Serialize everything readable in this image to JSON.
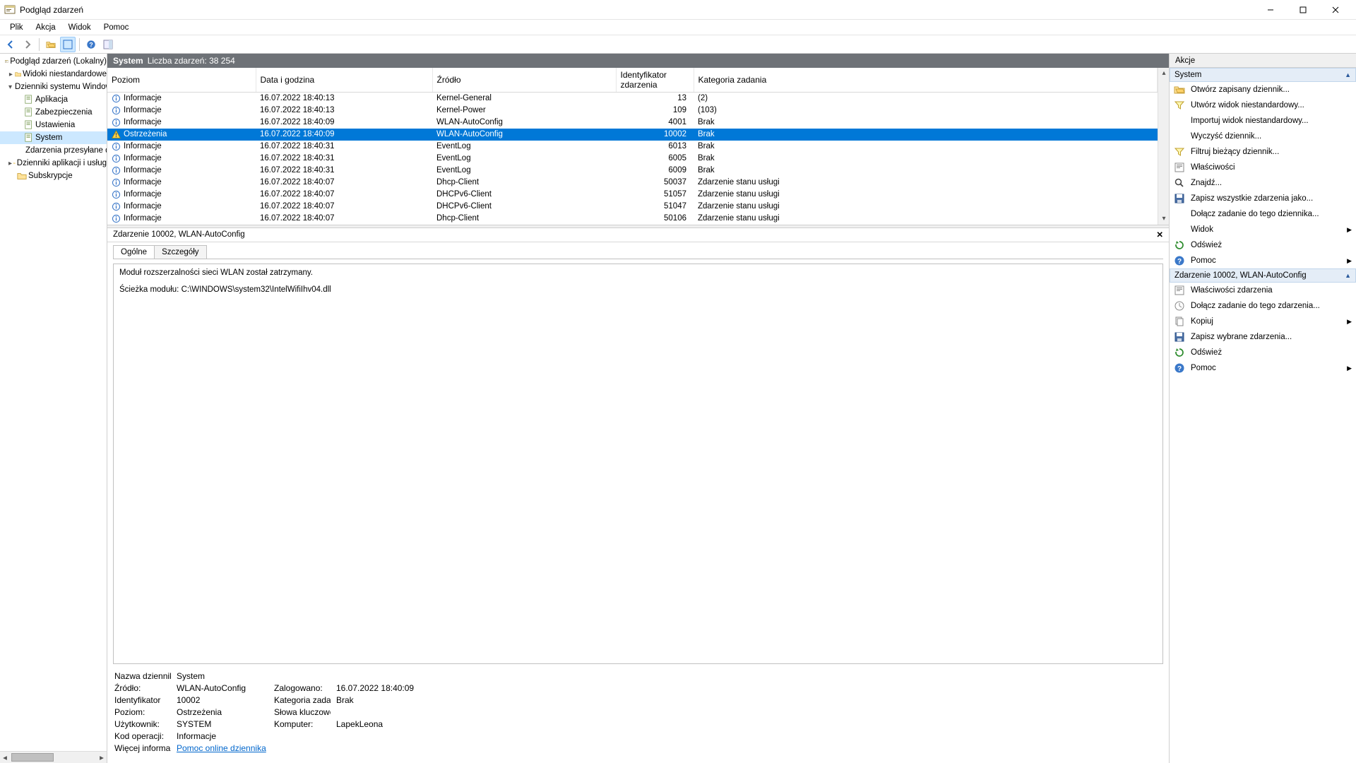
{
  "window": {
    "title": "Podgląd zdarzeń"
  },
  "menu": [
    "Plik",
    "Akcja",
    "Widok",
    "Pomoc"
  ],
  "tree": {
    "root": "Podgląd zdarzeń (Lokalny)",
    "custom_views": "Widoki niestandardowe",
    "windows_logs": "Dzienniki systemu Windows",
    "application": "Aplikacja",
    "security": "Zabezpieczenia",
    "setup": "Ustawienia",
    "system": "System",
    "forwarded": "Zdarzenia przesyłane dalej",
    "apps_services": "Dzienniki aplikacji i usług",
    "subscriptions": "Subskrypcje"
  },
  "list_header": {
    "name": "System",
    "count_label": "Liczba zdarzeń: 38 254"
  },
  "columns": {
    "level": "Poziom",
    "date": "Data i godzina",
    "source": "Źródło",
    "id": "Identyfikator zdarzenia",
    "cat": "Kategoria zadania"
  },
  "levels": {
    "info": "Informacje",
    "warn": "Ostrzeżenia"
  },
  "events": [
    {
      "lvl": "info",
      "date": "16.07.2022 18:40:13",
      "src": "Kernel-General",
      "id": "13",
      "cat": "(2)"
    },
    {
      "lvl": "info",
      "date": "16.07.2022 18:40:13",
      "src": "Kernel-Power",
      "id": "109",
      "cat": "(103)"
    },
    {
      "lvl": "info",
      "date": "16.07.2022 18:40:09",
      "src": "WLAN-AutoConfig",
      "id": "4001",
      "cat": "Brak"
    },
    {
      "lvl": "warn",
      "date": "16.07.2022 18:40:09",
      "src": "WLAN-AutoConfig",
      "id": "10002",
      "cat": "Brak",
      "sel": true
    },
    {
      "lvl": "info",
      "date": "16.07.2022 18:40:31",
      "src": "EventLog",
      "id": "6013",
      "cat": "Brak"
    },
    {
      "lvl": "info",
      "date": "16.07.2022 18:40:31",
      "src": "EventLog",
      "id": "6005",
      "cat": "Brak"
    },
    {
      "lvl": "info",
      "date": "16.07.2022 18:40:31",
      "src": "EventLog",
      "id": "6009",
      "cat": "Brak"
    },
    {
      "lvl": "info",
      "date": "16.07.2022 18:40:07",
      "src": "Dhcp-Client",
      "id": "50037",
      "cat": "Zdarzenie stanu usługi"
    },
    {
      "lvl": "info",
      "date": "16.07.2022 18:40:07",
      "src": "DHCPv6-Client",
      "id": "51057",
      "cat": "Zdarzenie stanu usługi"
    },
    {
      "lvl": "info",
      "date": "16.07.2022 18:40:07",
      "src": "DHCPv6-Client",
      "id": "51047",
      "cat": "Zdarzenie stanu usługi"
    },
    {
      "lvl": "info",
      "date": "16.07.2022 18:40:07",
      "src": "Dhcp-Client",
      "id": "50106",
      "cat": "Zdarzenie stanu usługi"
    }
  ],
  "detail": {
    "title": "Zdarzenie 10002, WLAN-AutoConfig",
    "tab_general": "Ogólne",
    "tab_details": "Szczegóły",
    "desc_line1": "Moduł rozszerzalności sieci WLAN został zatrzymany.",
    "desc_line2": "Ścieżka modułu: C:\\WINDOWS\\system32\\IntelWifiIhv04.dll",
    "labels": {
      "log_name": "Nazwa dziennika:",
      "source": "Źródło:",
      "eid": "Identyfikator",
      "level": "Poziom:",
      "user": "Użytkownik:",
      "opcode": "Kod operacji:",
      "more": "Więcej informacji:",
      "logged": "Zalogowano:",
      "cat": "Kategoria zadania:",
      "keywords": "Słowa kluczowe:",
      "computer": "Komputer:"
    },
    "values": {
      "log_name": "System",
      "source": "WLAN-AutoConfig",
      "eid": "10002",
      "level": "Ostrzeżenia",
      "user": "SYSTEM",
      "opcode": "Informacje",
      "logged": "16.07.2022 18:40:09",
      "cat": "Brak",
      "keywords": "",
      "computer": "LapekLeona",
      "more": "Pomoc online dziennika"
    }
  },
  "actions": {
    "title": "Akcje",
    "section_system": "System",
    "items_system": [
      {
        "ic": "open",
        "t": "Otwórz zapisany dziennik..."
      },
      {
        "ic": "filter",
        "t": "Utwórz widok niestandardowy..."
      },
      {
        "ic": "blank",
        "t": "Importuj widok niestandardowy..."
      },
      {
        "ic": "blank",
        "t": "Wyczyść dziennik..."
      },
      {
        "ic": "filter",
        "t": "Filtruj bieżący dziennik..."
      },
      {
        "ic": "props",
        "t": "Właściwości"
      },
      {
        "ic": "find",
        "t": "Znajdź..."
      },
      {
        "ic": "save",
        "t": "Zapisz wszystkie zdarzenia jako..."
      },
      {
        "ic": "blank",
        "t": "Dołącz zadanie do tego dziennika..."
      },
      {
        "ic": "blank",
        "t": "Widok",
        "sub": true
      },
      {
        "ic": "refresh",
        "t": "Odśwież"
      },
      {
        "ic": "help",
        "t": "Pomoc",
        "sub": true
      }
    ],
    "section_event": "Zdarzenie 10002, WLAN-AutoConfig",
    "items_event": [
      {
        "ic": "props",
        "t": "Właściwości zdarzenia"
      },
      {
        "ic": "task",
        "t": "Dołącz zadanie do tego zdarzenia..."
      },
      {
        "ic": "copy",
        "t": "Kopiuj",
        "sub": true
      },
      {
        "ic": "save",
        "t": "Zapisz wybrane zdarzenia..."
      },
      {
        "ic": "refresh",
        "t": "Odśwież"
      },
      {
        "ic": "help",
        "t": "Pomoc",
        "sub": true
      }
    ]
  }
}
